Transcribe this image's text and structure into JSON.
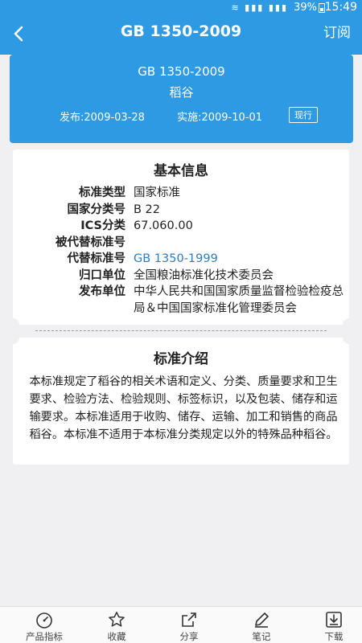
{
  "status": {
    "signal_text": "",
    "battery": "39%",
    "time": "15:49"
  },
  "nav": {
    "title": "GB 1350-2009",
    "subscribe": "订阅"
  },
  "header": {
    "code": "GB 1350-2009",
    "name": "稻谷",
    "publish": "发布:2009-03-28",
    "implement": "实施:2009-10-01",
    "status": "现行"
  },
  "info": {
    "title": "基本信息",
    "rows": [
      {
        "key": "标准类型",
        "value": "国家标准"
      },
      {
        "key": "国家分类号",
        "value": "B 22"
      },
      {
        "key": "ICS分类",
        "value": "67.060.00"
      },
      {
        "key": "被代替标准号",
        "value": ""
      },
      {
        "key": "代替标准号",
        "value": "GB 1350-1999"
      },
      {
        "key": "归口单位",
        "value": "全国粮油标准化技术委员会"
      },
      {
        "key": "发布单位",
        "value": "中华人民共和国国家质量监督检验检疫总局＆中国国家标准化管理委员会"
      }
    ]
  },
  "intro": {
    "title": "标准介绍",
    "text": "本标准规定了稻谷的相关术语和定义、分类、质量要求和卫生要求、检验方法、检验规则、标签标识，以及包装、储存和运输要求。本标准适用于收购、储存、运输、加工和销售的商品稻谷。本标准不适用于本标准分类规定以外的特殊品种稻谷。"
  },
  "tabs": [
    {
      "label": "产品指标",
      "icon": "gauge-icon"
    },
    {
      "label": "收藏",
      "icon": "star-icon"
    },
    {
      "label": "分享",
      "icon": "share-icon"
    },
    {
      "label": "笔记",
      "icon": "pencil-icon"
    },
    {
      "label": "下载",
      "icon": "download-icon"
    }
  ]
}
